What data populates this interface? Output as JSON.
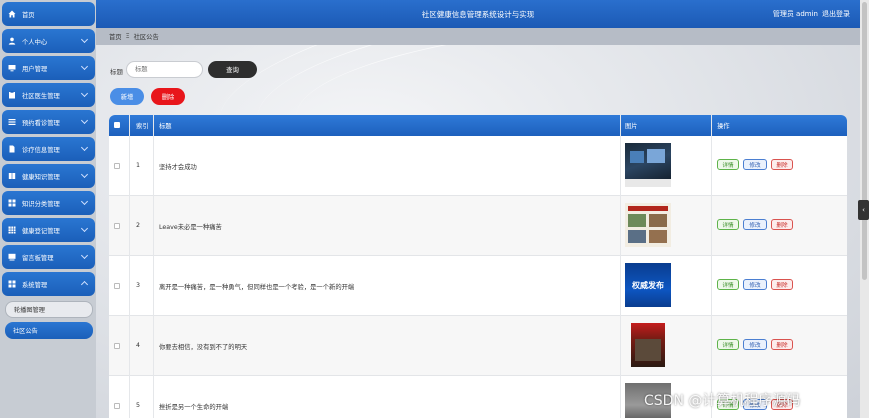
{
  "header": {
    "title": "社区健康信息管理系统设计与实现",
    "role_user": "管理员 admin",
    "logout": "退出登录"
  },
  "breadcrumb": {
    "home": "首页",
    "separator": "Ξ",
    "current": "社区公告"
  },
  "sidebar": {
    "items": [
      {
        "label": "首页",
        "icon": "home-icon",
        "has_chevron": false
      },
      {
        "label": "个人中心",
        "icon": "user-icon",
        "has_chevron": true
      },
      {
        "label": "用户管理",
        "icon": "monitor-icon",
        "has_chevron": true
      },
      {
        "label": "社区医生管理",
        "icon": "clipboard-icon",
        "has_chevron": true
      },
      {
        "label": "预约看诊管理",
        "icon": "list-icon",
        "has_chevron": true
      },
      {
        "label": "诊疗信息管理",
        "icon": "document-icon",
        "has_chevron": true
      },
      {
        "label": "健康知识管理",
        "icon": "book-icon",
        "has_chevron": true
      },
      {
        "label": "知识分类管理",
        "icon": "grid-icon",
        "has_chevron": true
      },
      {
        "label": "健康登记管理",
        "icon": "table-icon",
        "has_chevron": true
      },
      {
        "label": "留言板管理",
        "icon": "board-icon",
        "has_chevron": true
      },
      {
        "label": "系统管理",
        "icon": "grid-icon",
        "has_chevron": true
      }
    ],
    "sub_items": [
      {
        "label": "轮播图管理"
      },
      {
        "label": "社区公告"
      }
    ]
  },
  "search": {
    "label": "标题",
    "placeholder": "标题",
    "button": "查询"
  },
  "toolbar": {
    "add": "新增",
    "delete": "删除"
  },
  "table": {
    "headers": {
      "index": "索引",
      "title": "标题",
      "image": "图片",
      "actions": "操作"
    },
    "rows": [
      {
        "index": "1",
        "title": "坚持才会成功"
      },
      {
        "index": "2",
        "title": "Leave未必是一种痛苦"
      },
      {
        "index": "3",
        "title": "离开是一种痛苦，是一种勇气，但同样也是一个考验，是一个新的开端"
      },
      {
        "index": "4",
        "title": "你要去相信，没有到不了的明天"
      },
      {
        "index": "5",
        "title": "挫折是另一个生命的开端"
      }
    ],
    "actions": {
      "detail": "详情",
      "edit": "修改",
      "delete": "删除"
    },
    "thumb_text": {
      "row3": "权威发布"
    }
  },
  "watermark": "CSDN @计算机程序源码",
  "colors": {
    "primary": "#1d60bd",
    "danger": "#e8161b",
    "sidebar_bg": "#c7ccd3"
  }
}
